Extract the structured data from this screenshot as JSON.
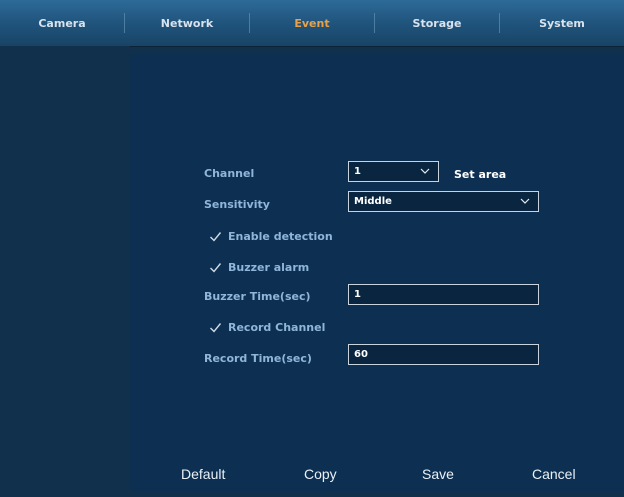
{
  "tabs": [
    {
      "label": "Camera",
      "active": false
    },
    {
      "label": "Network",
      "active": false
    },
    {
      "label": "Event",
      "active": true
    },
    {
      "label": "Storage",
      "active": false
    },
    {
      "label": "System",
      "active": false
    }
  ],
  "colors": {
    "active_tab": "#e8a24a",
    "label": "#8fb6d9",
    "panel": "#0d3052"
  },
  "form": {
    "channel_label": "Channel",
    "channel_value": "1",
    "set_area_label": "Set area",
    "sensitivity_label": "Sensitivity",
    "sensitivity_value": "Middle",
    "enable_detection_label": "Enable detection",
    "buzzer_alarm_label": "Buzzer alarm",
    "buzzer_time_label": "Buzzer Time(sec)",
    "buzzer_time_value": "1",
    "record_channel_label": "Record Channel",
    "record_time_label": "Record Time(sec)",
    "record_time_value": "60"
  },
  "icons": {
    "check": "checkmark-icon",
    "dropdown": "chevron-down-icon"
  },
  "buttons": {
    "default_label": "Default",
    "copy_label": "Copy",
    "save_label": "Save",
    "cancel_label": "Cancel"
  }
}
